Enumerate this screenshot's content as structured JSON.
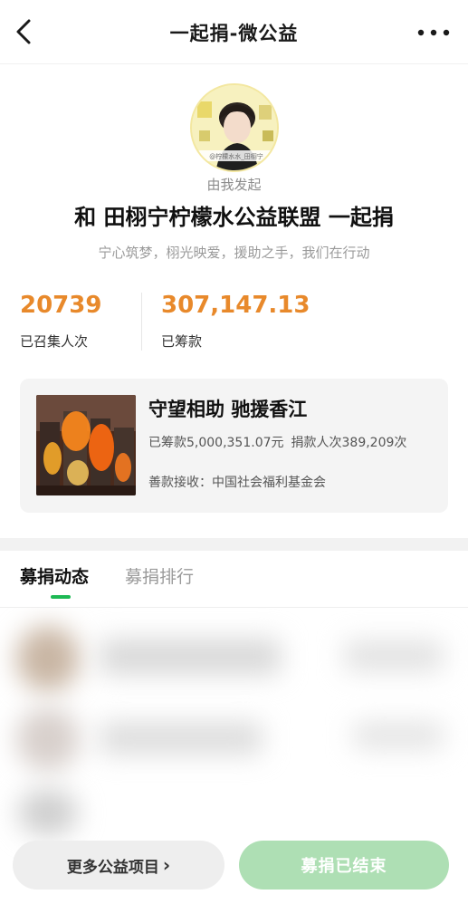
{
  "nav": {
    "title": "一起捐-微公益"
  },
  "profile": {
    "sponsor_text": "由我发起",
    "campaign_title": "和 田栩宁柠檬水公益联盟 一起捐",
    "slogan": "宁心筑梦，栩光映爱，援助之手，我们在行动",
    "avatar_caption": "@柠檬水水_田栩宁"
  },
  "stats": [
    {
      "value": "20739",
      "label": "已召集人次"
    },
    {
      "value": "307,147.13",
      "label": "已筹款"
    }
  ],
  "project": {
    "title": "守望相助 驰援香江",
    "raised": "已筹款5,000,351.07元",
    "donors": "捐款人次389,209次",
    "recipient": "善款接收：中国社会福利基金会"
  },
  "tabs": [
    {
      "label": "募捐动态",
      "active": true
    },
    {
      "label": "募捐排行",
      "active": false
    }
  ],
  "buttons": {
    "more_projects": "更多公益项目",
    "more_projects_chevron": "›",
    "ended": "募捐已结束"
  },
  "colors": {
    "accent_orange": "#e8892b",
    "brand_green": "#1db954",
    "ended_button_green": "#aedfb4"
  },
  "icons": {
    "back": "chevron-left-icon",
    "more": "more-dots-icon"
  }
}
